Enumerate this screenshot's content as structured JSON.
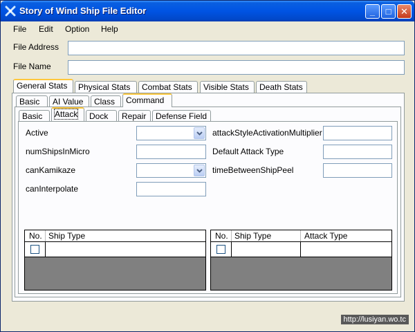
{
  "window": {
    "title": "Story of Wind Ship File Editor",
    "controls": {
      "minimize": "_",
      "maximize": "□",
      "close": "✕"
    }
  },
  "menu": [
    "File",
    "Edit",
    "Option",
    "Help"
  ],
  "fields": {
    "file_address": {
      "label": "File Address",
      "value": ""
    },
    "file_name": {
      "label": "File Name",
      "value": ""
    }
  },
  "tabs_level1": [
    "General Stats",
    "Physical Stats",
    "Combat Stats",
    "Visible Stats",
    "Death Stats"
  ],
  "tabs_level2": [
    "Basic",
    "AI Value",
    "Class",
    "Command"
  ],
  "tabs_level3": [
    "Basic",
    "Attack",
    "Dock",
    "Repair",
    "Defense Field"
  ],
  "attack": {
    "left": [
      {
        "label": "Active",
        "type": "combo",
        "value": ""
      },
      {
        "label": "numShipsInMicro",
        "type": "text",
        "value": ""
      },
      {
        "label": "canKamikaze",
        "type": "combo",
        "value": ""
      },
      {
        "label": "canInterpolate",
        "type": "text",
        "value": ""
      }
    ],
    "right": [
      {
        "label": "attackStyleActivationMultiplier",
        "value": ""
      },
      {
        "label": "Default Attack Type",
        "value": ""
      },
      {
        "label": "timeBetweenShipPeel",
        "value": ""
      }
    ]
  },
  "grid_left": {
    "columns": [
      "No.",
      "Ship Type"
    ]
  },
  "grid_right": {
    "columns": [
      "No.",
      "Ship Type",
      "Attack Type"
    ]
  },
  "status": {
    "watermark": "http://lusiyan.wo.tc"
  },
  "colors": {
    "titlebar": "#0054e3",
    "tab_highlight": "#ffc83c",
    "grid_empty": "#808080"
  },
  "icons": {
    "app": "wind-ship-icon",
    "dropdown": "chevron-down-icon"
  }
}
